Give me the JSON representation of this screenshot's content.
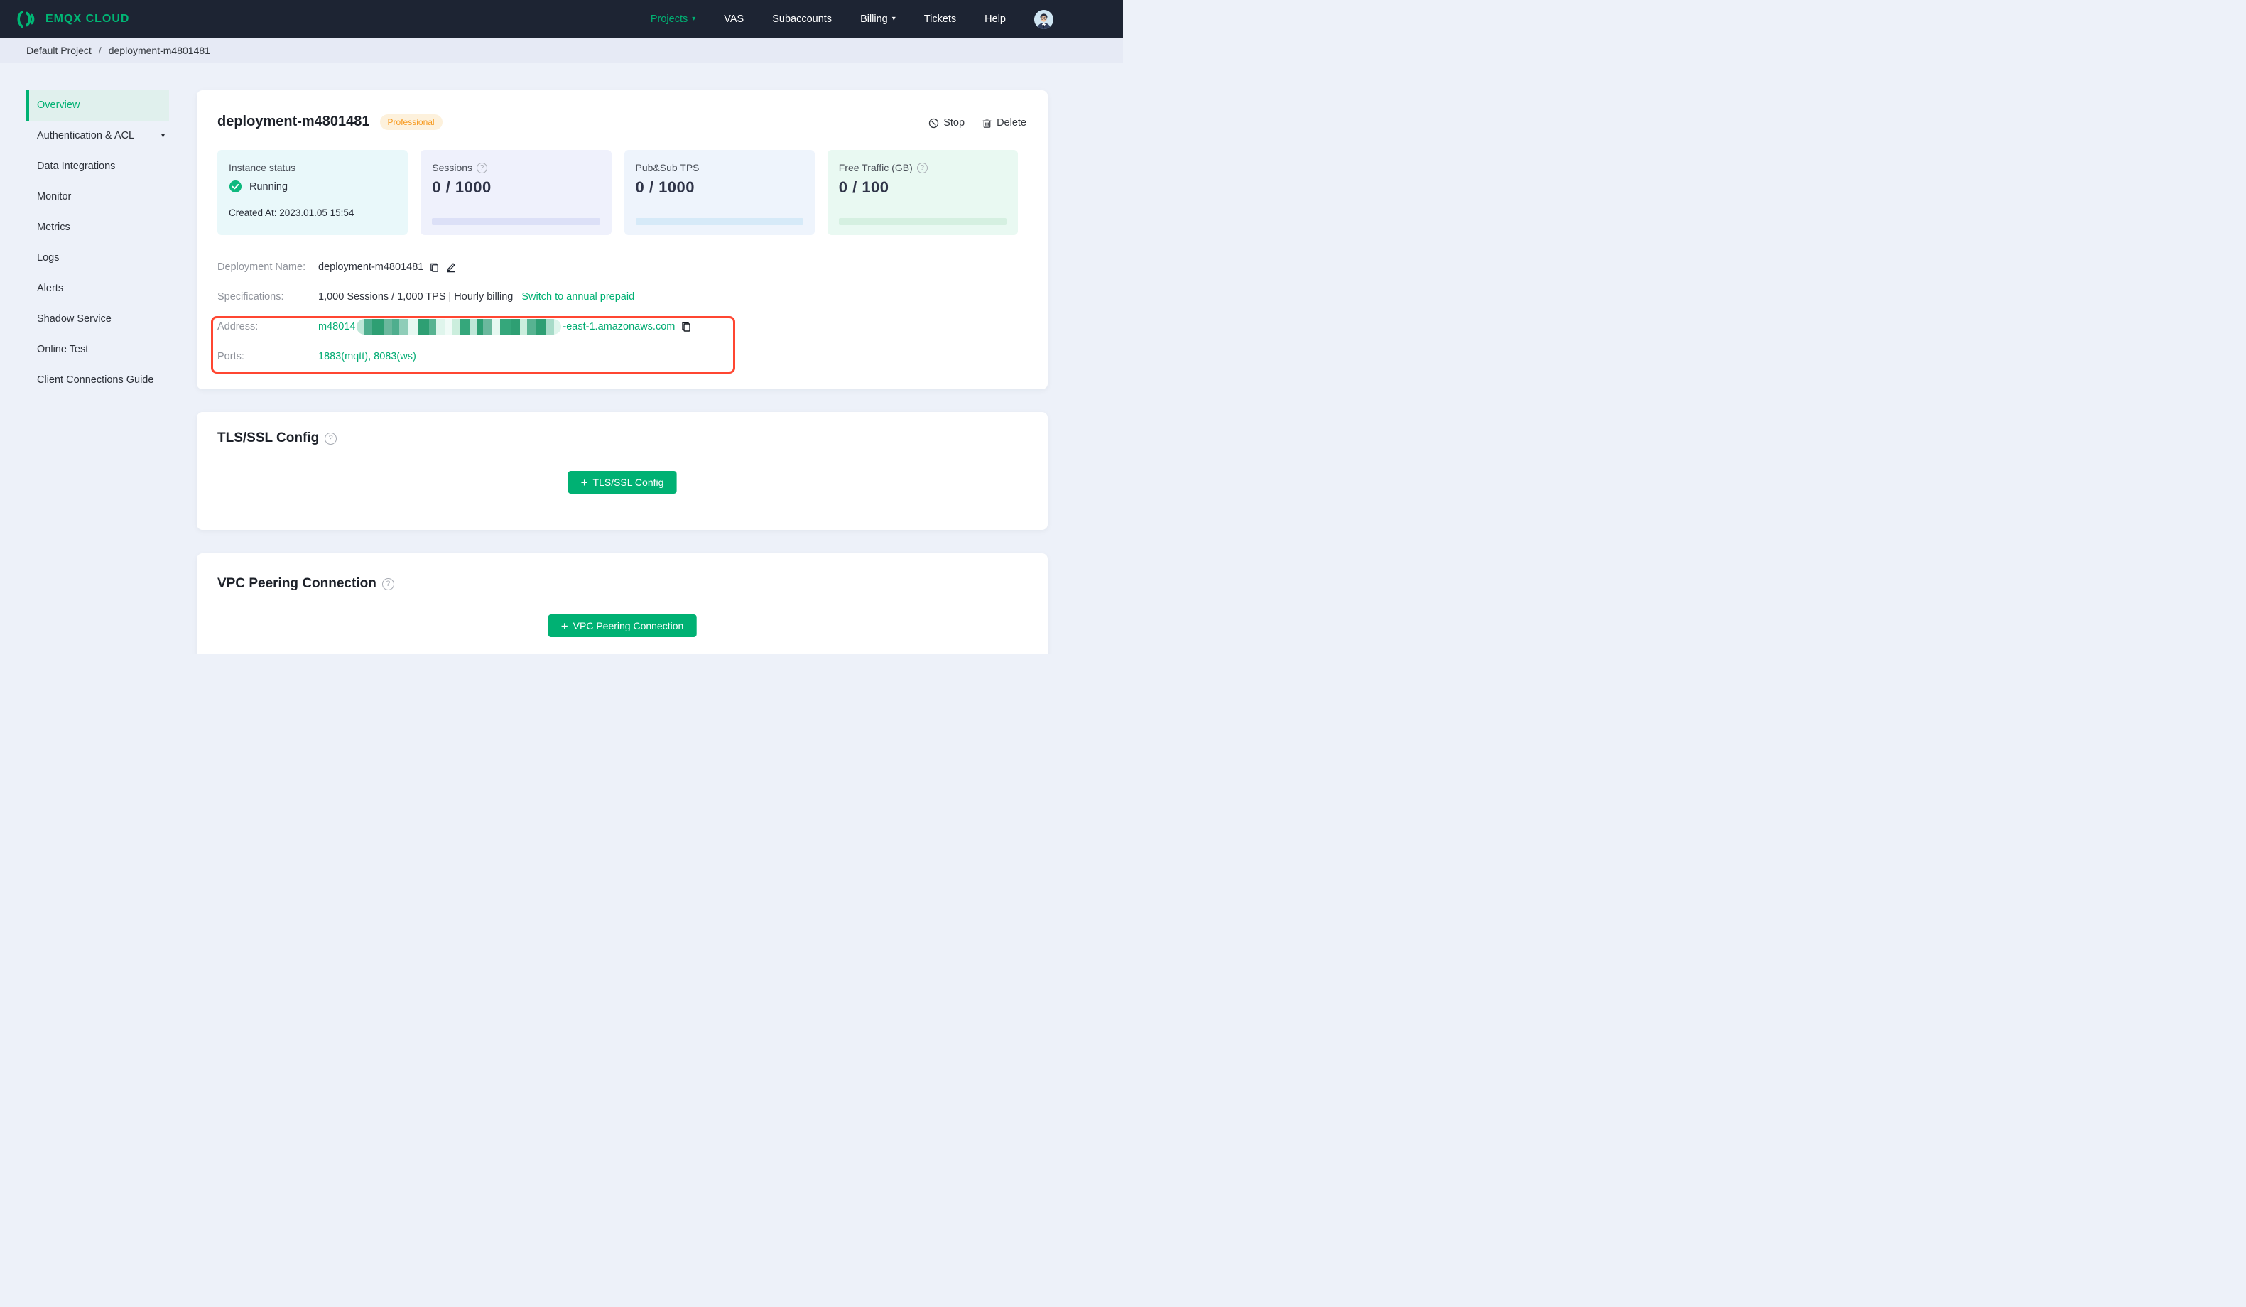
{
  "navbar": {
    "brand": "EMQX CLOUD",
    "items": [
      {
        "label": "Projects",
        "active": true,
        "caret": true
      },
      {
        "label": "VAS"
      },
      {
        "label": "Subaccounts"
      },
      {
        "label": "Billing",
        "caret": true
      },
      {
        "label": "Tickets"
      },
      {
        "label": "Help"
      }
    ]
  },
  "breadcrumb": {
    "items": [
      "Default Project",
      "deployment-m4801481"
    ]
  },
  "sidebar": {
    "items": [
      {
        "label": "Overview",
        "active": true
      },
      {
        "label": "Authentication & ACL",
        "caret": true
      },
      {
        "label": "Data Integrations"
      },
      {
        "label": "Monitor"
      },
      {
        "label": "Metrics"
      },
      {
        "label": "Logs"
      },
      {
        "label": "Alerts"
      },
      {
        "label": "Shadow Service"
      },
      {
        "label": "Online Test"
      },
      {
        "label": "Client Connections Guide"
      }
    ]
  },
  "deployment": {
    "title": "deployment-m4801481",
    "plan_badge": "Professional",
    "actions": {
      "stop": "Stop",
      "delete": "Delete"
    },
    "stats": [
      {
        "label": "Instance status",
        "status": "Running",
        "created": "Created At: 2023.01.05 15:54"
      },
      {
        "label": "Sessions",
        "value": "0 / 1000",
        "help": true
      },
      {
        "label": "Pub&Sub TPS",
        "value": "0 / 1000"
      },
      {
        "label": "Free Traffic (GB)",
        "value": "0 / 100",
        "help": true
      }
    ],
    "details": {
      "name": {
        "label": "Deployment Name:",
        "value": "deployment-m4801481"
      },
      "specs": {
        "label": "Specifications:",
        "value": "1,000 Sessions / 1,000 TPS | Hourly billing",
        "link": "Switch to annual prepaid"
      },
      "address": {
        "label": "Address:",
        "prefix": "m48014",
        "suffix": "-east-1.amazonaws.com",
        "redacted": true
      },
      "ports": {
        "label": "Ports:",
        "value": "1883(mqtt), 8083(ws)"
      }
    }
  },
  "sections": {
    "tls": {
      "title": "TLS/SSL Config",
      "button_label": "TLS/SSL Config"
    },
    "vpc": {
      "title": "VPC Peering Connection",
      "button_label": "VPC Peering Connection"
    }
  },
  "icons": {
    "caret_down": "▾",
    "question": "?",
    "plus": "+",
    "separator": "/"
  },
  "colors": {
    "navbar_bg": "#1D2433",
    "brand_green": "#00B173",
    "page_bg": "#EDF1F9",
    "breadcrumb_bg": "#E6EAF5",
    "sidebar_active_bg": "#E0F0ED",
    "badge_bg": "#FDF1DC",
    "badge_text": "#F79A1F",
    "status_green": "#0FB97E",
    "highlight_red": "#FF4631",
    "stat_instance_bg": "#E9F8FA",
    "stat_sessions_bg": "#EFF1FC",
    "stat_tps_bg": "#EEF4FC",
    "stat_traffic_bg": "#E9F9F2"
  },
  "redaction": {
    "blocks": [
      {
        "w": 10,
        "c": "#BFE7D8"
      },
      {
        "w": 12,
        "c": "#4FAE8E"
      },
      {
        "w": 16,
        "c": "#2E9F73"
      },
      {
        "w": 12,
        "c": "#6BB89D"
      },
      {
        "w": 10,
        "c": "#4FAE8E"
      },
      {
        "w": 12,
        "c": "#8FCDB8"
      },
      {
        "w": 14,
        "c": "#E6F8F1"
      },
      {
        "w": 16,
        "c": "#2E9F73"
      },
      {
        "w": 10,
        "c": "#57B391"
      },
      {
        "w": 12,
        "c": "#DFF5EC"
      },
      {
        "w": 10,
        "c": "#F0FBF7"
      },
      {
        "w": 12,
        "c": "#CBEEDD"
      },
      {
        "w": 14,
        "c": "#35A77B"
      },
      {
        "w": 10,
        "c": "#BFE7D8"
      },
      {
        "w": 8,
        "c": "#2E9F73"
      },
      {
        "w": 12,
        "c": "#6BB89D"
      },
      {
        "w": 12,
        "c": "#E6F8F1"
      },
      {
        "w": 16,
        "c": "#35A77B"
      },
      {
        "w": 12,
        "c": "#2E9F73"
      },
      {
        "w": 10,
        "c": "#CBEEDD"
      },
      {
        "w": 12,
        "c": "#57B391"
      },
      {
        "w": 14,
        "c": "#2E9F73"
      },
      {
        "w": 12,
        "c": "#A7DBC8"
      },
      {
        "w": 10,
        "c": "#DFF5EC"
      }
    ]
  }
}
